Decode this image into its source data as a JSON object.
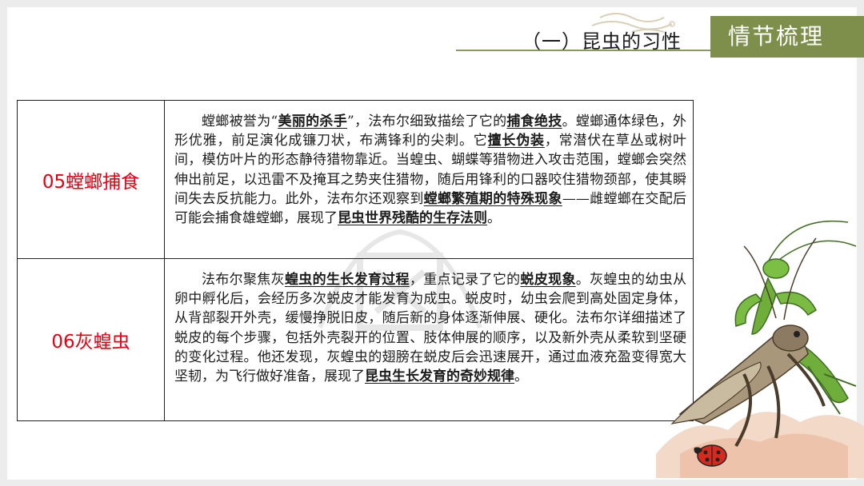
{
  "header": {
    "section_title": "（一）昆虫的习性",
    "badge": "情节梳理"
  },
  "rows": [
    {
      "label": "05螳螂捕食",
      "segments": [
        {
          "t": "螳螂被誉为“",
          "b": false
        },
        {
          "t": "美丽的杀手",
          "b": true
        },
        {
          "t": "”，法布尔细致描绘了它的",
          "b": false
        },
        {
          "t": "捕食绝技",
          "b": true
        },
        {
          "t": "。螳螂通体绿色，外形优雅，前足演化成镰刀状，布满锋利的尖刺。它",
          "b": false
        },
        {
          "t": "擅长伪装",
          "b": true
        },
        {
          "t": "，常潜伏在草丛或树叶间，模仿叶片的形态静待猎物靠近。当蝗虫、蝴蝶等猎物进入攻击范围，螳螂会突然伸出前足，以迅雷不及掩耳之势夹住猎物，随后用锋利的口器咬住猎物颈部，使其瞬间失去反抗能力。此外，法布尔还观察到",
          "b": false
        },
        {
          "t": "螳螂繁殖期的特殊现象",
          "b": true
        },
        {
          "t": "——雌螳螂在交配后可能会捕食雄螳螂，展现了",
          "b": false
        },
        {
          "t": "昆虫世界残酷的生存法则",
          "b": true
        },
        {
          "t": "。",
          "b": false
        }
      ]
    },
    {
      "label": "06灰蝗虫",
      "segments": [
        {
          "t": "法布尔聚焦灰",
          "b": false
        },
        {
          "t": "蝗虫的生长发育过程",
          "b": true
        },
        {
          "t": "，重点记录了它的",
          "b": false
        },
        {
          "t": "蜕皮现象",
          "b": true
        },
        {
          "t": "。灰蝗虫的幼虫从卵中孵化后，会经历多次蜕皮才能发育为成虫。蜕皮时，幼虫会爬到高处固定身体，从背部裂开外壳，缓慢挣脱旧皮，随后新的身体逐渐伸展、硬化。法布尔详细描述了蜕皮的每个步骤，包括外壳裂开的位置、肢体伸展的顺序，以及新外壳从柔软到坚硬的变化过程。他还发现，灰蝗虫的翅膀在蜕皮后会迅速展开，通过血液充盈变得宽大坚韧，为飞行做好准备，展现了",
          "b": false
        },
        {
          "t": "昆虫生长发育的奇妙规律",
          "b": true
        },
        {
          "t": "。",
          "b": false
        }
      ]
    }
  ],
  "colors": {
    "accent_green": "#7d8f4a",
    "label_red": "#e60012",
    "mantis_green": "#6fae3a",
    "grasshopper_brown": "#8c7b62",
    "ladybug_red": "#d62a1e"
  },
  "icons": [
    "swirl-ornament-icon",
    "mantis-illustration",
    "grasshopper-illustration",
    "ladybug-icon",
    "ink-mountain-decoration",
    "watermark-seal"
  ]
}
